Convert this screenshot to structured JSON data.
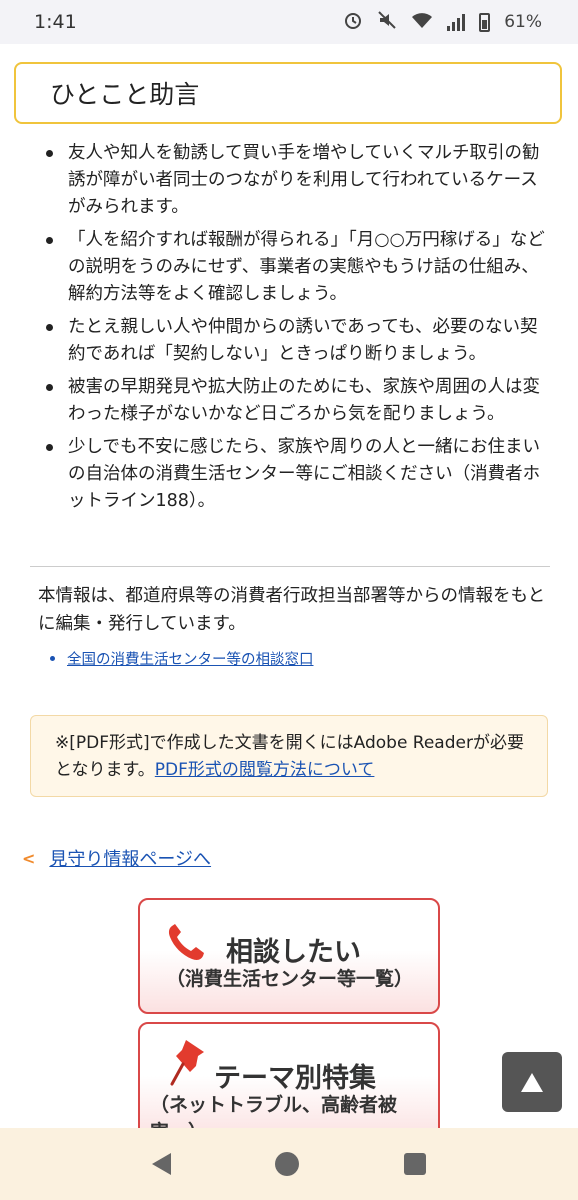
{
  "status_bar": {
    "time": "1:41",
    "battery_percent": "61%",
    "icons": [
      "alarm-icon",
      "mute-icon",
      "wifi-icon",
      "signal-icon",
      "battery-icon"
    ]
  },
  "advice": {
    "heading": "ひとこと助言",
    "bullets": [
      "友人や知人を勧誘して買い手を増やしていくマルチ取引の勧誘が障がい者同士のつながりを利用して行われているケースがみられます。",
      "「人を紹介すれば報酬が得られる」「月○○万円稼げる」などの説明をうのみにせず、事業者の実態やもうけ話の仕組み、解約方法等をよく確認しましょう。",
      "たとえ親しい人や仲間からの誘いであっても、必要のない契約であれば「契約しない」ときっぱり断りましょう。",
      "被害の早期発見や拡大防止のためにも、家族や周囲の人は変わった様子がないかなど日ごろから気を配りましょう。",
      "少しでも不安に感じたら、家族や周りの人と一緒にお住まいの自治体の消費生活センター等にご相談ください（消費者ホットライン188）。"
    ]
  },
  "info": {
    "text": "本情報は、都道府県等の消費者行政担当部署等からの情報をもとに編集・発行しています。",
    "consult_link": "全国の消費生活センター等の相談窓口"
  },
  "pdf_note": {
    "text": "※[PDF形式]で作成した文書を開くにはAdobe Readerが必要となります。",
    "link": "PDF形式の閲覧方法について"
  },
  "back_link": "見守り情報ページへ",
  "buttons": {
    "consult": {
      "title": "相談したい",
      "sub": "（消費生活センター等一覧）"
    },
    "theme": {
      "title": "テーマ別特集",
      "sub": "（ネットトラブル、高齢者被害…）"
    }
  },
  "colors": {
    "accent_yellow": "#f0c43c",
    "link_blue": "#1a53b3",
    "button_red": "#d94848",
    "nav_bg": "#fbf1df"
  }
}
